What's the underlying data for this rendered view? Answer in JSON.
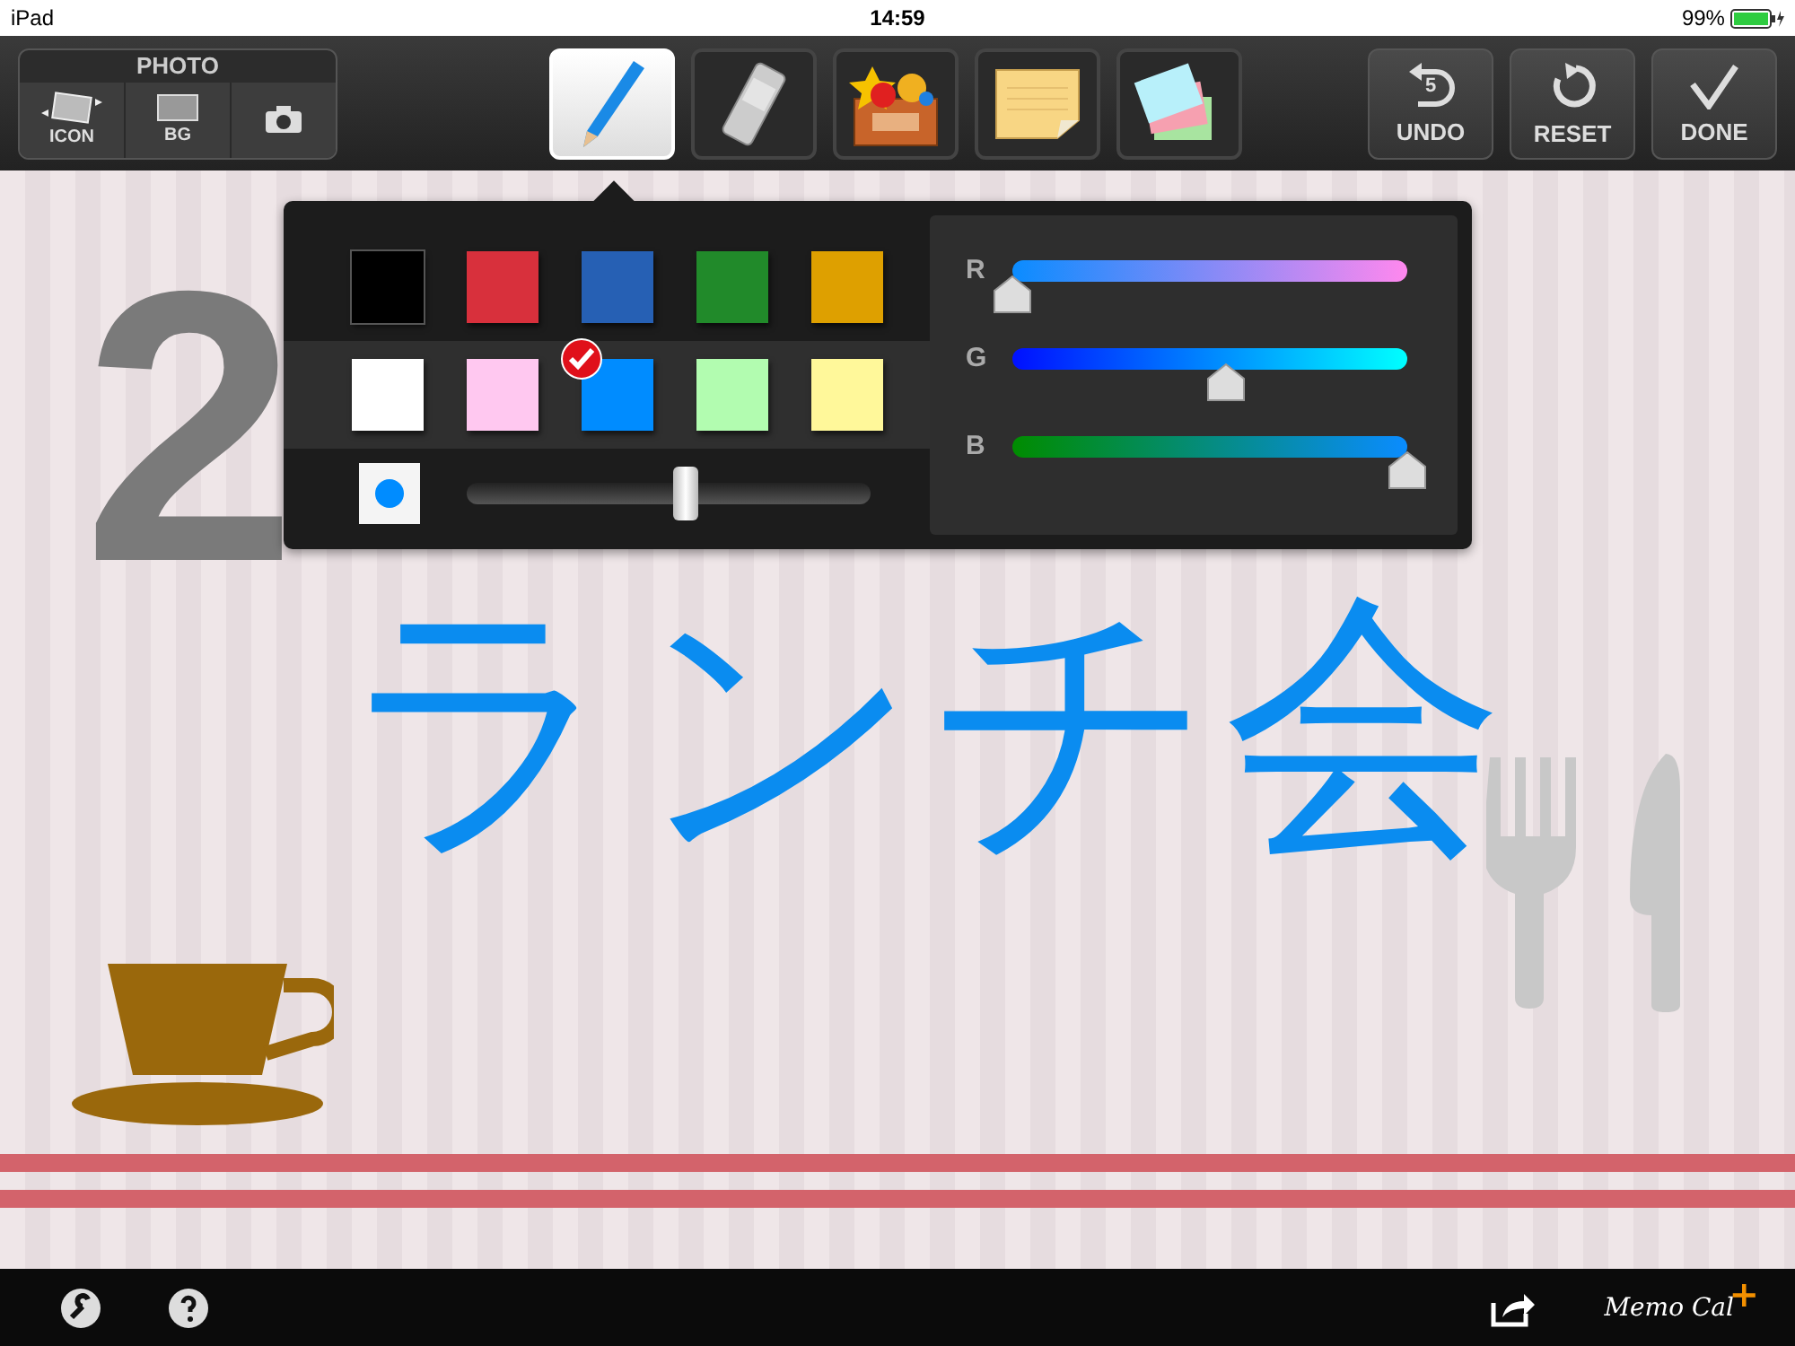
{
  "status_bar": {
    "device": "iPad",
    "time": "14:59",
    "battery": "99%"
  },
  "photo_group": {
    "title": "PHOTO",
    "buttons": [
      {
        "kind": "icon",
        "label": "ICON"
      },
      {
        "kind": "bg",
        "label": "BG"
      },
      {
        "kind": "camera"
      }
    ]
  },
  "tools": [
    {
      "kind": "pencil",
      "selected": true
    },
    {
      "kind": "eraser",
      "selected": false
    },
    {
      "kind": "stamps",
      "selected": false
    },
    {
      "kind": "note",
      "selected": false
    },
    {
      "kind": "cards",
      "selected": false
    }
  ],
  "actions": [
    {
      "kind": "undo",
      "label": "UNDO",
      "badge": "5"
    },
    {
      "kind": "reset",
      "label": "RESET"
    },
    {
      "kind": "done",
      "label": "DONE"
    }
  ],
  "palette": {
    "swatches": [
      {
        "color": "#000000",
        "selected": false
      },
      {
        "color": "#d8303c",
        "selected": false
      },
      {
        "color": "#2660b4",
        "selected": false
      },
      {
        "color": "#218a2a",
        "selected": false
      },
      {
        "color": "#dea000",
        "selected": false
      },
      {
        "color": "#ffffff",
        "selected": false
      },
      {
        "color": "#ffc8f0",
        "selected": false
      },
      {
        "color": "#008cff",
        "selected": true
      },
      {
        "color": "#b2fcb0",
        "selected": false
      },
      {
        "color": "#fff89a",
        "selected": false
      }
    ],
    "size": {
      "level": 0.54
    },
    "channels": [
      {
        "label": "R",
        "level": 0
      },
      {
        "label": "G",
        "level": 0.54
      },
      {
        "label": "B",
        "level": 1
      }
    ]
  },
  "canvas": {
    "date": "2",
    "handwriting": "ランチ会"
  },
  "bottom_bar": {
    "logo": "Memo Cal",
    "logo_mark": "+"
  }
}
